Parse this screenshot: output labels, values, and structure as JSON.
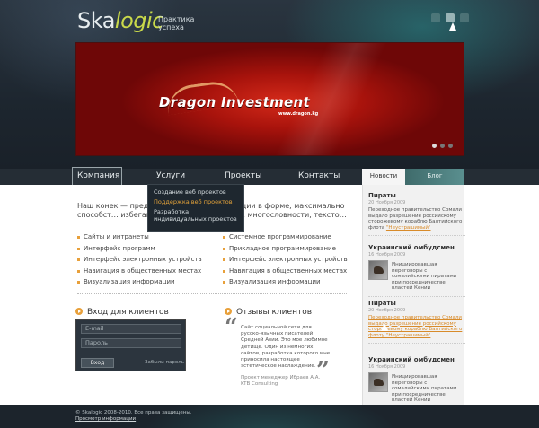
{
  "header": {
    "logo_main": "Ska",
    "logo_accent": "logic",
    "tagline": "Практика успеха"
  },
  "banner": {
    "brand": "Dragon Investment",
    "url": "www.dragon.kg"
  },
  "nav": {
    "items": [
      "Компания",
      "Услуги",
      "Проекты",
      "Контакты"
    ],
    "dropdown": [
      "Создание веб проектов",
      "Поддержка веб проектов",
      "Разработка индивидуальных проектов"
    ]
  },
  "tabs": {
    "news": "Новости",
    "blog": "Блог"
  },
  "intro": {
    "text": "Наш конек — предст… структуре информации в форме, максимально способст… избегающей двусмысленностей, многословности, тексто…"
  },
  "services_left": [
    "Сайты и интранеты",
    "Интерфейс программ",
    "Интерфейс электронных устройств",
    "Навигация в общественных местах",
    "Визуализация информации"
  ],
  "services_right": [
    "Системное программирование",
    "Прикладное программирование",
    "Интерфейс электронных устройств",
    "Навигация в общественных местах",
    "Визуализация информации"
  ],
  "login": {
    "title": "Вход для клиентов",
    "email_placeholder": "E-mail",
    "password_placeholder": "Пароль",
    "button": "Вход",
    "forgot": "Забыли пароль"
  },
  "reviews": {
    "title": "Отзывы клиентов",
    "text": "Сайт социальной сети для русско-язычных писателей Средней Азии. Это мое любимое детище. Один из немногих сайтов, разработка которого мне приносила настоящее эстетическое наслаждение.",
    "author": "Проект менеджер Ибраев А.А. KTB Consulting"
  },
  "news": [
    {
      "title": "Пираты",
      "date": "20 Ноября 2009",
      "text": "Переходное правительство Сомали выдало разрешение российскому сторожевому кораблю Балтийского флота ",
      "link": "\"Неустрашимый\""
    },
    {
      "title": "Украинский омбудсмен",
      "date": "16 Ноября 2009",
      "text": "Инициировавшая переговоры с сомалийскими пиратами при посредничестве властей Кении"
    },
    {
      "title": "Пираты",
      "date": "20 Ноября 2009",
      "text": "",
      "link": "Переходное правительство Сомали выдало разрешение российскому сторожевому кораблю Балтийского флоту \"Неустрашимый\""
    },
    {
      "title": "Украинский омбудсмен",
      "date": "16 Ноября 2009",
      "text": "Инициировавшая переговоры с сомалийскими пиратами при посредничестве властей Кении"
    }
  ],
  "footer": {
    "copyright": "© Skalogic 2008-2010. Все права защищены.",
    "link": "Просмотр информации"
  }
}
